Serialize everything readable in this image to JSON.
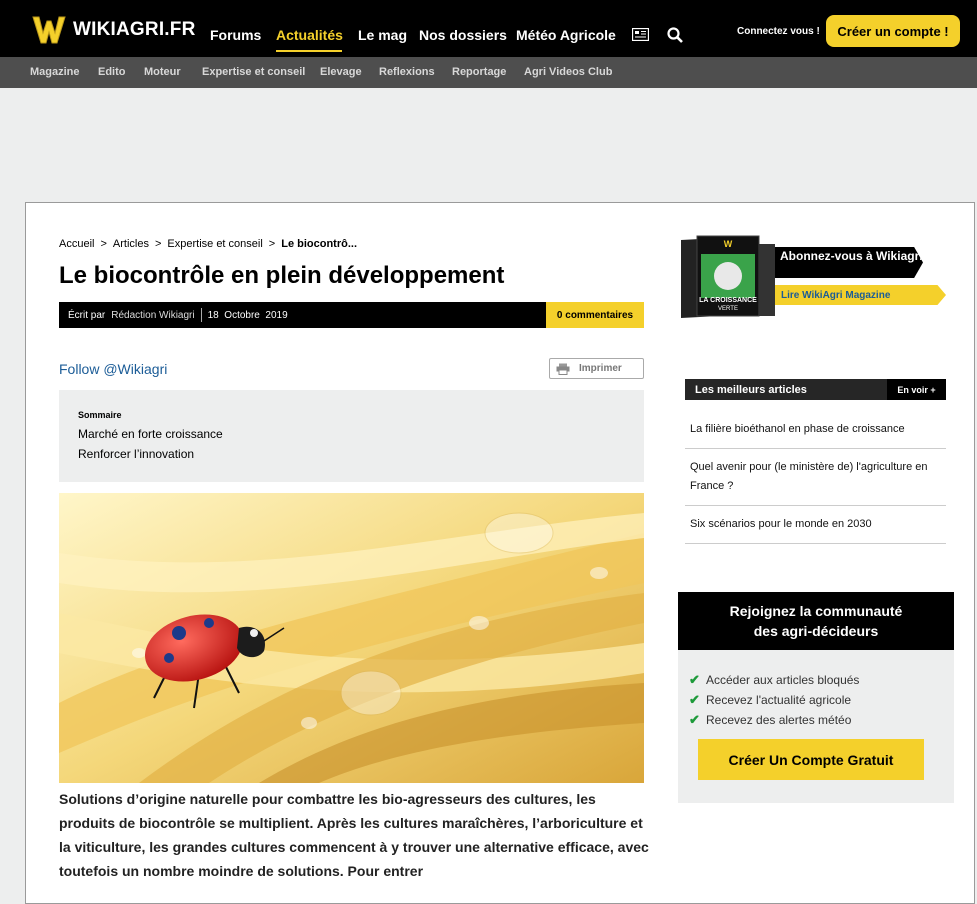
{
  "header": {
    "logo_text": "WIKIAGRI.FR",
    "nav": [
      "Forums",
      "Actualités",
      "Le mag",
      "Nos dossiers",
      "Météo Agricole"
    ],
    "active_nav": "Actualités",
    "connect_label": "Connectez vous !",
    "create_account_label": "Créer un compte !"
  },
  "subnav": [
    "Magazine",
    "Edito",
    "Moteur",
    "Expertise et conseil",
    "Elevage",
    "Reflexions",
    "Reportage",
    "Agri Videos Club"
  ],
  "breadcrumb": [
    "Accueil",
    "Articles",
    "Expertise et conseil",
    "Le biocontrô..."
  ],
  "article": {
    "title": "Le biocontrôle en plein développement",
    "written_by_label": "Écrit par",
    "author": "Rédaction Wikiagri",
    "date": "18  Octobre  2019",
    "comments": "0 commentaires",
    "follow": "Follow @Wikiagri",
    "print": "Imprimer",
    "summary_title": "Sommaire",
    "summary_items": [
      "Marché en forte croissance",
      "Renforcer l’innovation"
    ],
    "body": "Solutions d’origine naturelle pour combattre les bio-agresseurs des cultures, les produits de biocontrôle se multiplient. Après les cultures maraîchères, l’arboriculture et la viticulture, les grandes cultures commencent à y trouver une alternative efficace, avec toutefois un nombre moindre de solutions. Pour entrer"
  },
  "sidebar": {
    "promo_title": "Abonnez-vous à Wikiagri",
    "promo_link": "Lire WikiAgri Magazine",
    "magazine_cover_text": "LA CROISSANCE VERTE",
    "best_title": "Les meilleurs articles",
    "best_more": "En voir +",
    "best_items": [
      "La filière bioéthanol en phase de croissance",
      "Quel avenir pour (le ministère de) l'agriculture en France ?",
      "Six scénarios pour le monde en 2030"
    ],
    "join_title": "Rejoignez la communauté des agri-décideurs",
    "join_items": [
      "Accéder aux articles bloqués",
      "Recevez l'actualité agricole",
      "Recevez des alertes météo"
    ],
    "join_button": "Créer Un Compte Gratuit"
  },
  "colors": {
    "accent": "#f4d02b",
    "link": "#1b5c97",
    "dark": "#000000"
  }
}
